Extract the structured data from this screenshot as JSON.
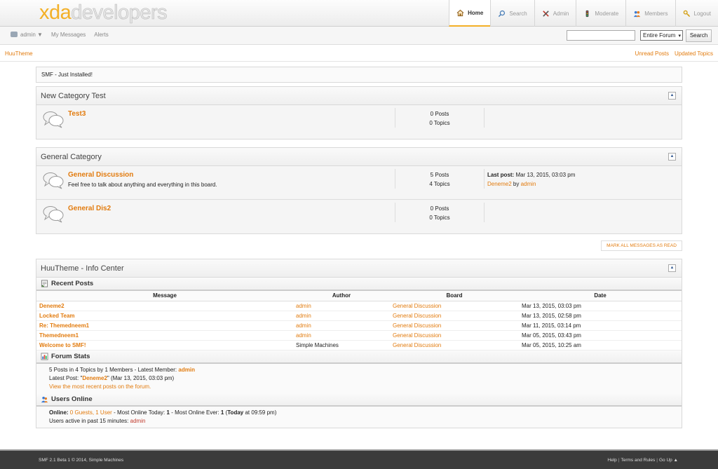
{
  "logo": {
    "part1": "xda",
    "part2": "developers"
  },
  "nav": [
    {
      "label": "Home",
      "icon": "home-icon",
      "active": true
    },
    {
      "label": "Search",
      "icon": "search-icon"
    },
    {
      "label": "Admin",
      "icon": "admin-tools-icon"
    },
    {
      "label": "Moderate",
      "icon": "moderate-icon"
    },
    {
      "label": "Members",
      "icon": "members-icon"
    },
    {
      "label": "Logout",
      "icon": "logout-key-icon"
    }
  ],
  "userbar": {
    "user": "admin ▼",
    "messages": "My Messages",
    "alerts": "Alerts"
  },
  "search": {
    "placeholder": "",
    "scope": "Entire Forum",
    "button": "Search"
  },
  "breadcrumb": {
    "home": "HuuTheme",
    "unread": "Unread Posts",
    "updated": "Updated Topics"
  },
  "news": "SMF - Just Installed!",
  "categories": [
    {
      "title": "New Category Test",
      "boards": [
        {
          "name": "Test3",
          "desc": "",
          "posts": "0 Posts",
          "topics": "0 Topics"
        }
      ]
    },
    {
      "title": "General Category",
      "boards": [
        {
          "name": "General Discussion",
          "desc": "Feel free to talk about anything and everything in this board.",
          "posts": "5 Posts",
          "topics": "4 Topics",
          "last_label": "Last post:",
          "last_date": "Mar 13, 2015, 03:03 pm",
          "last_topic": "Deneme2",
          "last_by": "by",
          "last_author": "admin"
        },
        {
          "name": "General Dis2",
          "desc": "",
          "posts": "0 Posts",
          "topics": "0 Topics"
        }
      ]
    }
  ],
  "mark_read": "MARK ALL MESSAGES AS READ",
  "info": {
    "title": "HuuTheme - Info Center",
    "recent_title": "Recent Posts",
    "columns": [
      "Message",
      "Author",
      "Board",
      "Date"
    ],
    "rows": [
      {
        "message": "Deneme2",
        "author": "admin",
        "board": "General Discussion",
        "date": "Mar 13, 2015, 03:03 pm"
      },
      {
        "message": "Locked Team",
        "author": "admin",
        "board": "General Discussion",
        "date": "Mar 13, 2015, 02:58 pm"
      },
      {
        "message": "Re: Themedneem1",
        "author": "admin",
        "board": "General Discussion",
        "date": "Mar 11, 2015, 03:14 pm"
      },
      {
        "message": "Themedneem1",
        "author": "admin",
        "board": "General Discussion",
        "date": "Mar 05, 2015, 03:43 pm"
      },
      {
        "message": "Welcome to SMF!",
        "author": "Simple Machines",
        "board": "General Discussion",
        "date": "Mar 05, 2015, 10:25 am"
      }
    ],
    "stats_title": "Forum Stats",
    "stats_line1": "5 Posts in 4 Topics by 1 Members - Latest Member:",
    "stats_member": "admin",
    "stats_line2_pre": "Latest Post: \"",
    "stats_latest": "Deneme2",
    "stats_line2_post": "\" (Mar 13, 2015, 03:03 pm)",
    "stats_link": "View the most recent posts on the forum.",
    "online_title": "Users Online",
    "online_label": "Online:",
    "online_users": "0 Guests, 1 User",
    "online_mid": " - Most Online Today:",
    "online_today": "1",
    "online_mid2": " - Most Online Ever:",
    "online_ever": "1",
    "online_open": "(",
    "online_today_word": "Today",
    "online_at": "at 09:59 pm)",
    "active_label": "Users active in past 15 minutes:",
    "active_user": "admin"
  },
  "footer": {
    "copyright": "SMF 2.1 Beta 1 © 2014, Simple Machines",
    "help": "Help",
    "terms": "Terms and Rules",
    "goup": "Go Up ▲",
    "sep": "|"
  },
  "colors": {
    "accent": "#e27b0e",
    "logo": "#f3b027",
    "footer": "#3b3b3b"
  }
}
